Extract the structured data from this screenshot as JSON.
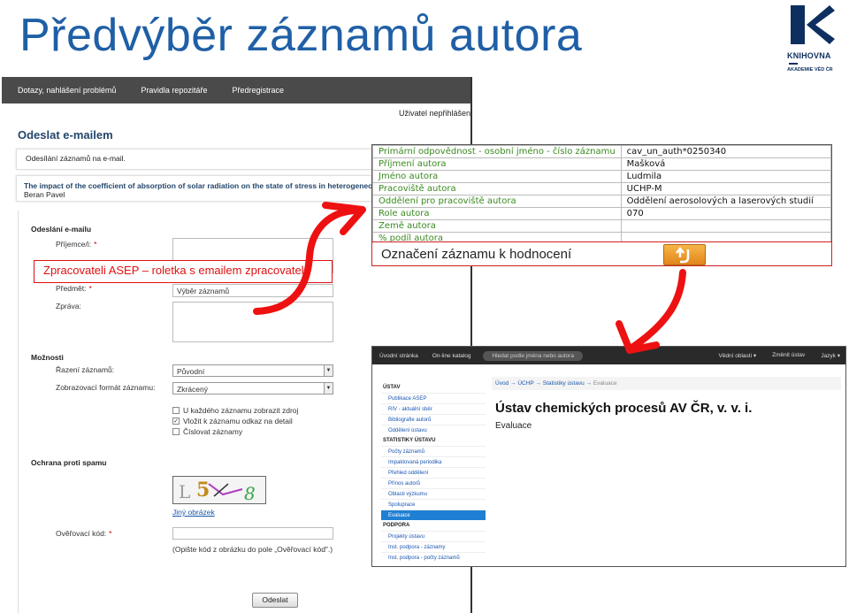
{
  "slide": {
    "title": "Předvýběr záznamů autora",
    "logo_text1": "KNIHOVNA",
    "logo_text2": "AKADEMIE VĚD ČR"
  },
  "email_form": {
    "nav": [
      "Dotazy, nahlášení problémů",
      "Pravidla repozitáře",
      "Předregistrace"
    ],
    "user": "Uživatel nepřihlášen",
    "heading": "Odeslat e-mailem",
    "subheading": "Odesílání záznamů na e-mail.",
    "record_title": "The impact of the coefficient of absorption of solar radiation on the state of stress in heterogeneous",
    "record_author": "Beran Pavel",
    "section_send": "Odeslání e-mailu",
    "recipient_label": "Příjemce/i:",
    "subject_label": "Předmět:",
    "subject_value": "Výběr záznamů",
    "message_label": "Zpráva:",
    "section_options": "Možnosti",
    "sort_label": "Řazení záznamů:",
    "sort_value": "Původní",
    "format_label": "Zobrazovací formát záznamu:",
    "format_value": "Zkrácený",
    "checkboxes": [
      {
        "label": "U každého záznamu zobrazit zdroj",
        "checked": false
      },
      {
        "label": "Vložit k záznamu odkaz na detail",
        "checked": true
      },
      {
        "label": "Číslovat záznamy",
        "checked": false
      }
    ],
    "section_spam": "Ochrana proti spamu",
    "other_image_link": "Jiný obrázek",
    "code_label": "Ověřovací kód:",
    "code_hint": "(Opište kód z obrázku do pole „Ověřovací kód\".)",
    "send_button": "Odeslat",
    "required_mark": "*"
  },
  "callout_asep": "Zpracovateli ASEP – roletka s emailem zpracovatele",
  "record_table": [
    {
      "key": "Primární odpovědnost - osobní jméno - číslo záznamu",
      "value": "cav_un_auth*0250340"
    },
    {
      "key": "Příjmení autora",
      "value": "Mašková"
    },
    {
      "key": "Jméno autora",
      "value": "Ludmila"
    },
    {
      "key": "Pracoviště autora",
      "value": "UCHP-M"
    },
    {
      "key": "Oddělení pro pracoviště autora",
      "value": "Oddělení aerosolových a laserových studií"
    },
    {
      "key": "Role autora",
      "value": "070"
    },
    {
      "key": "Země autora",
      "value": ""
    },
    {
      "key": "% podíl autora",
      "value": ""
    }
  ],
  "oznaceni": "Označení záznamu k hodnocení",
  "portal": {
    "nav": [
      "Úvodní stránka",
      "On-line katalog"
    ],
    "search_placeholder": "Hledat podle jména nebo autora",
    "nav_right": [
      "Vědní oblasti ▾",
      "Změnit ústav",
      "Jazyk ▾"
    ],
    "sidebar": [
      {
        "type": "hdr",
        "label": "ÚSTAV"
      },
      {
        "type": "it",
        "label": "Publikace ASEP"
      },
      {
        "type": "it",
        "label": "RIV - aktuální sběr"
      },
      {
        "type": "it",
        "label": "Bibliografie autorů"
      },
      {
        "type": "it",
        "label": "Oddělení ústavu"
      },
      {
        "type": "hdr",
        "label": "STATISTIKY ÚSTAVU"
      },
      {
        "type": "it",
        "label": "Počty záznamů"
      },
      {
        "type": "it",
        "label": "Impaktovaná periodika"
      },
      {
        "type": "it",
        "label": "Přehled oddělení"
      },
      {
        "type": "it",
        "label": "Přínos autorů"
      },
      {
        "type": "it",
        "label": "Oblasti výzkumu"
      },
      {
        "type": "it",
        "label": "Spoluprace"
      },
      {
        "type": "it",
        "label": "Evaluace",
        "active": true
      },
      {
        "type": "hdr",
        "label": "PODPORA"
      },
      {
        "type": "it",
        "label": "Projekty ústavu"
      },
      {
        "type": "it",
        "label": "Inst. podpora - záznamy"
      },
      {
        "type": "it",
        "label": "Inst. podpora - počty záznamů"
      }
    ],
    "breadcrumb": [
      "Úvod",
      "ÚCHP",
      "Statistiky ústavu"
    ],
    "breadcrumb_current": "Evaluace",
    "heading": "Ústav chemických procesů AV ČR, v. v. i.",
    "subheading": "Evaluace"
  },
  "colors": {
    "title_blue": "#1f5fa6",
    "callout_red": "#e01010",
    "arrow_red": "#ee1111",
    "field_green": "#3a8a1f",
    "active_blue": "#1f7fd2"
  }
}
